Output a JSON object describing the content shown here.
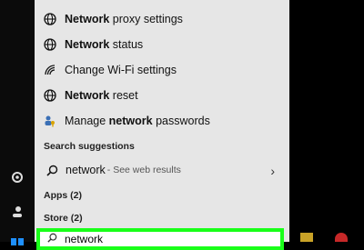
{
  "results": [
    {
      "icon": "globe-icon",
      "bold": "Network",
      "rest": " proxy settings"
    },
    {
      "icon": "globe-icon",
      "bold": "Network",
      "rest": " status"
    },
    {
      "icon": "wifi-icon",
      "bold": "",
      "rest": "Change Wi-Fi settings"
    },
    {
      "icon": "globe-icon",
      "bold": "Network",
      "rest": " reset"
    },
    {
      "icon": "key-people-icon",
      "pre": "Manage ",
      "bold": "network",
      "rest": " passwords"
    }
  ],
  "sections": {
    "suggestions": "Search suggestions",
    "apps": "Apps (2)",
    "store": "Store (2)"
  },
  "suggestion": {
    "query": "network",
    "sub": " - See web results"
  },
  "search": {
    "value": "network"
  },
  "colors": {
    "highlight": "#19ff19",
    "panel": "#e6e6e6"
  }
}
